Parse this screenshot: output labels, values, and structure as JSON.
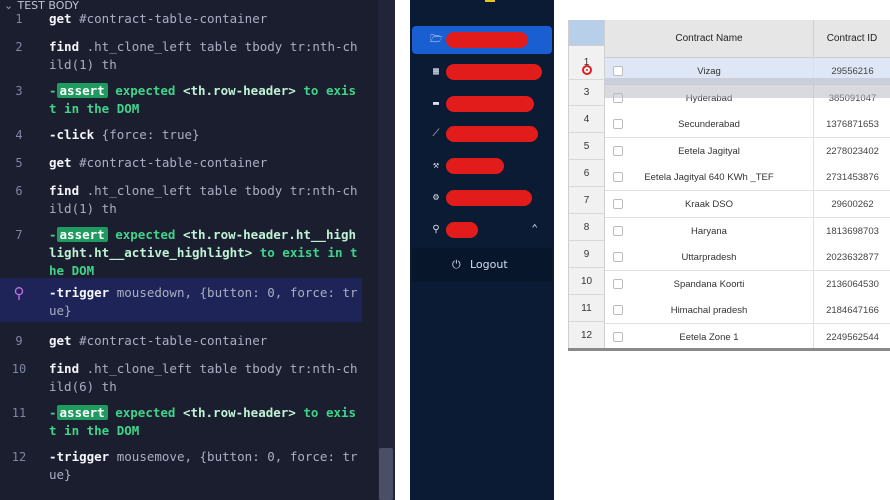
{
  "runner": {
    "section_title": "TEST BODY",
    "commands": [
      {
        "num": "1",
        "parts": [
          {
            "t": "get",
            "c": "kw"
          },
          {
            "t": "  #contract-table-container",
            "c": "sel"
          }
        ]
      },
      {
        "num": "2",
        "parts": [
          {
            "t": "find",
            "c": "kw"
          },
          {
            "t": "  .ht_clone_left table tbody tr:nth-child(1) th",
            "c": "sel"
          }
        ]
      },
      {
        "num": "3",
        "parts": [
          {
            "t": "-",
            "c": "green"
          },
          {
            "t": "assert",
            "c": "badge"
          },
          {
            "t": "  expected ",
            "c": "green"
          },
          {
            "t": "<th.row-header>",
            "c": "gw"
          },
          {
            "t": " to exist in the DOM",
            "c": "green"
          }
        ]
      },
      {
        "num": "4",
        "parts": [
          {
            "t": "-click",
            "c": "kw"
          },
          {
            "t": "  {force: true}",
            "c": "sel"
          }
        ]
      },
      {
        "num": "5",
        "parts": [
          {
            "t": "get",
            "c": "kw"
          },
          {
            "t": "  #contract-table-container",
            "c": "sel"
          }
        ]
      },
      {
        "num": "6",
        "parts": [
          {
            "t": "find",
            "c": "kw"
          },
          {
            "t": "  .ht_clone_left table tbody tr:nth-child(1) th",
            "c": "sel"
          }
        ]
      },
      {
        "num": "7",
        "parts": [
          {
            "t": "-",
            "c": "green"
          },
          {
            "t": "assert",
            "c": "badge"
          },
          {
            "t": "  expected ",
            "c": "green"
          },
          {
            "t": "<th.row-header.ht__highlight.ht__active_highlight>",
            "c": "gw"
          },
          {
            "t": " to exist in the DOM",
            "c": "green"
          }
        ]
      },
      {
        "num": "",
        "pin": true,
        "parts": [
          {
            "t": "-trigger",
            "c": "kw"
          },
          {
            "t": "  mousedown, {button: 0, force: true}",
            "c": "sel"
          }
        ]
      },
      {
        "num": "9",
        "parts": [
          {
            "t": "get",
            "c": "kw"
          },
          {
            "t": "  #contract-table-container",
            "c": "sel"
          }
        ]
      },
      {
        "num": "10",
        "parts": [
          {
            "t": "find",
            "c": "kw"
          },
          {
            "t": "  .ht_clone_left table tbody tr:nth-child(6) th",
            "c": "sel"
          }
        ]
      },
      {
        "num": "11",
        "parts": [
          {
            "t": "-",
            "c": "green"
          },
          {
            "t": "assert",
            "c": "badge"
          },
          {
            "t": "  expected ",
            "c": "green"
          },
          {
            "t": "<th.row-header>",
            "c": "gw"
          },
          {
            "t": " to exist in the DOM",
            "c": "green"
          }
        ]
      },
      {
        "num": "12",
        "parts": [
          {
            "t": "-trigger",
            "c": "kw"
          },
          {
            "t": "  mousemove, {button: 0, force: true}",
            "c": "sel"
          }
        ]
      }
    ]
  },
  "sidebar": {
    "items": [
      {
        "icon": "folder-icon",
        "glyph": "🗁"
      },
      {
        "icon": "calendar-icon",
        "glyph": "▦"
      },
      {
        "icon": "box-icon",
        "glyph": "▬"
      },
      {
        "icon": "chart-icon",
        "glyph": "⟋"
      },
      {
        "icon": "hammer-icon",
        "glyph": "⚒"
      },
      {
        "icon": "gear-icon",
        "glyph": "⚙"
      },
      {
        "icon": "user-icon",
        "glyph": "⚲"
      }
    ],
    "logout_label": "Logout",
    "logout_glyph": "⏻"
  },
  "table": {
    "columns": [
      "Contract Name",
      "Contract ID"
    ],
    "row_numbers": [
      "1",
      "3",
      "4",
      "5",
      "6",
      "7",
      "8",
      "9",
      "10",
      "11",
      "12"
    ],
    "rows": [
      {
        "name": "Vizag",
        "id": "29556216"
      },
      {
        "name": "Hyderabad",
        "id": "385091047"
      },
      {
        "name": "Secunderabad",
        "id": "1376871653"
      },
      {
        "name": "Eetela Jagityal",
        "id": "2278023402"
      },
      {
        "name": "Eetela Jagityal 640 KWh _TEF",
        "id": "2731453876"
      },
      {
        "name": "Kraak DSO",
        "id": "29600262"
      },
      {
        "name": "Haryana",
        "id": "1813698703"
      },
      {
        "name": "Uttarpradesh",
        "id": "2023632877"
      },
      {
        "name": "Spandana Koorti",
        "id": "2136064530"
      },
      {
        "name": "Himachal pradesh",
        "id": "2184647166"
      },
      {
        "name": "Eetela Zone 1",
        "id": "2249562544"
      }
    ]
  },
  "colors": {
    "accent": "#1a5fd1",
    "runner_bg": "#1b1e2e",
    "sidebar_bg": "#0a1b33",
    "redaction": "#e21b1b"
  }
}
